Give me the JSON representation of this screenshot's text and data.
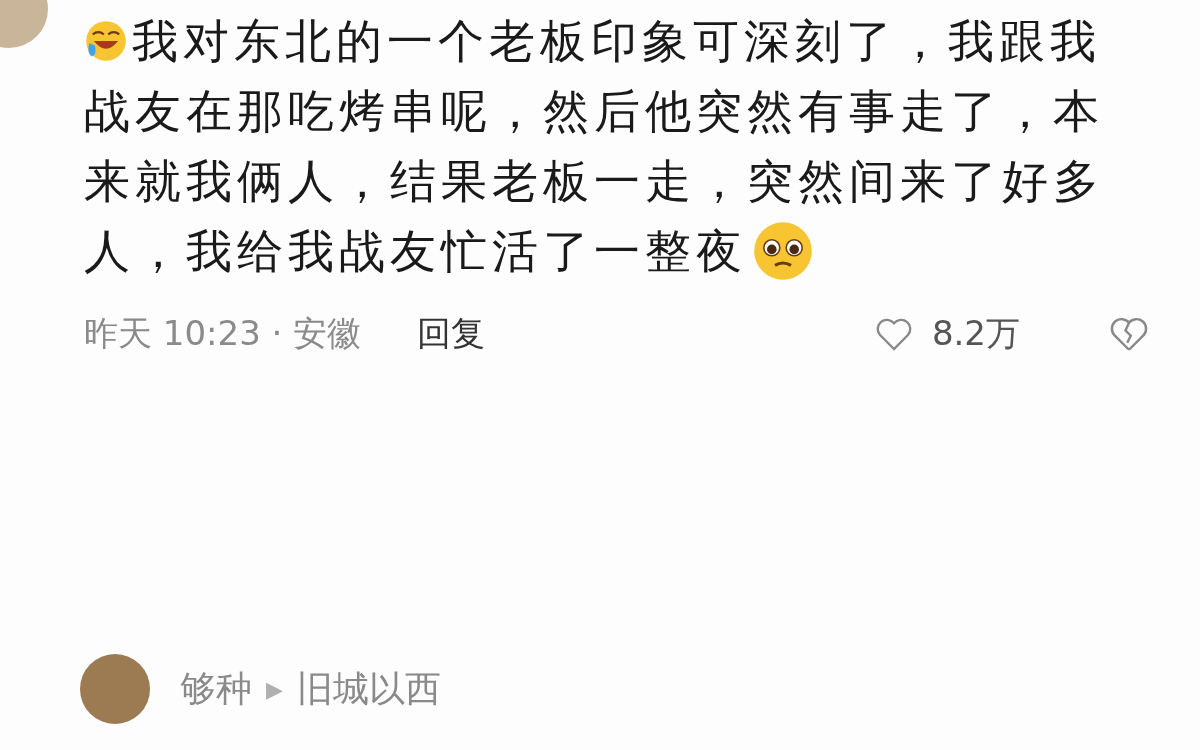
{
  "comment": {
    "lines": [
      "我对东北的一个老板印象可深刻了，我跟我",
      "战友在那吃烤串呢，然后他突然有事走了，本",
      "来就我俩人，结果老板一走，突然间来了好多",
      "人，我给我战友忙活了一整夜"
    ],
    "time_location": "昨天 10:23 · 安徽",
    "reply_label": "回复",
    "likes": "8.2万"
  },
  "reply": {
    "author": "够种",
    "arrow": "▶",
    "reply_to": "旧城以西"
  }
}
